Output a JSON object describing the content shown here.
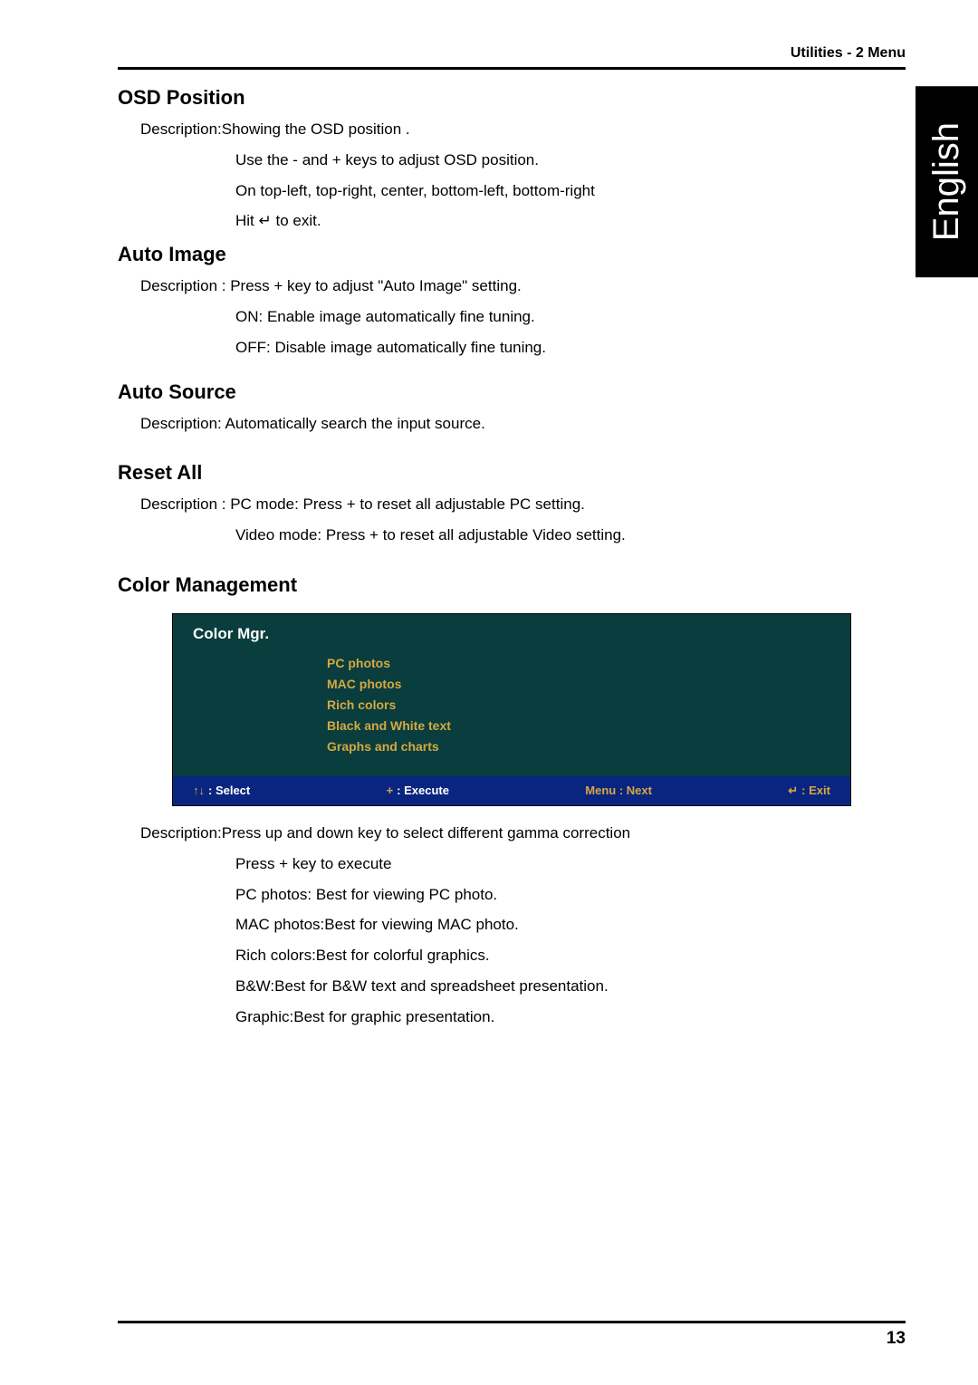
{
  "header": {
    "breadcrumb": "Utilities - 2 Menu"
  },
  "language_tab": "English",
  "sections": {
    "osd_position": {
      "heading": "OSD Position",
      "line1": "Description:Showing the OSD position .",
      "line2": "Use the - and + keys to adjust OSD position.",
      "line3": "On top-left, top-right, center, bottom-left, bottom-right",
      "line4": "Hit ↵ to exit."
    },
    "auto_image": {
      "heading": "Auto Image",
      "line1": "Description : Press + key to adjust \"Auto Image\" setting.",
      "line2": "ON: Enable image automatically fine tuning.",
      "line3": "OFF: Disable image automatically fine tuning."
    },
    "auto_source": {
      "heading": "Auto Source",
      "line1": "Description: Automatically search the input source."
    },
    "reset_all": {
      "heading": "Reset All",
      "line1": "Description : PC mode: Press + to reset all adjustable PC setting.",
      "line2": "Video mode: Press + to reset all adjustable Video setting."
    },
    "color_management": {
      "heading": "Color Management",
      "panel": {
        "title": "Color Mgr.",
        "items": [
          "PC photos",
          "MAC photos",
          "Rich colors",
          "Black and White text",
          "Graphs and charts"
        ],
        "footer": {
          "select_icon": "↑↓",
          "select_label": " : Select",
          "execute_icon": "+",
          "execute_label": " : Execute",
          "menu_label": "Menu : Next",
          "exit_icon": "↵",
          "exit_label": " : Exit"
        }
      },
      "desc1": "Description:Press up and down key to select different gamma correction",
      "desc2": "Press + key to execute",
      "desc3": "PC photos: Best for viewing PC photo.",
      "desc4": "MAC photos:Best for viewing MAC photo.",
      "desc5": "Rich colors:Best for colorful graphics.",
      "desc6": "B&W:Best for B&W text and spreadsheet presentation.",
      "desc7": "Graphic:Best for graphic presentation."
    }
  },
  "page_number": "13"
}
